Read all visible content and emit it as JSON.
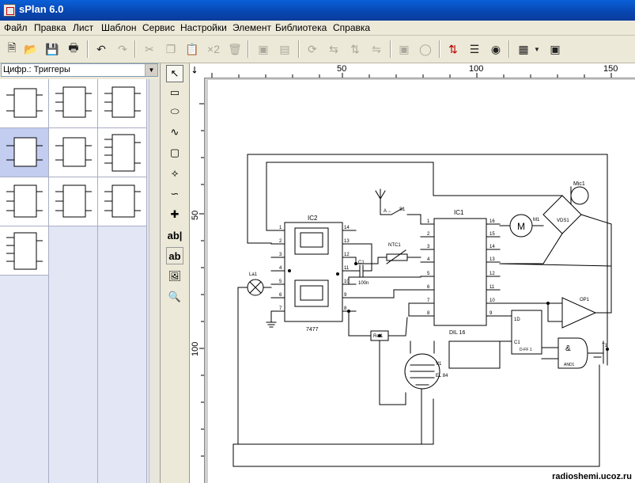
{
  "window": {
    "title": "sPlan 6.0"
  },
  "menu": [
    "Файл",
    "Правка",
    "Лист",
    "Шаблон",
    "Сервис",
    "Настройки",
    "Элемент",
    "Библиотека",
    "Справка"
  ],
  "library": {
    "selected": "Цифр.: Триггеры"
  },
  "ruler": {
    "h_ticks": [
      "50",
      "100",
      "150"
    ],
    "v_ticks": [
      "50",
      "100"
    ]
  },
  "schematic": {
    "ic2_label": "IC2",
    "ic2_part": "7477",
    "ic1_label": "IC1",
    "ic1_part": "DIL 16",
    "ic1_left_pins": [
      "1",
      "2",
      "3",
      "4",
      "5",
      "6",
      "7",
      "8"
    ],
    "ic1_right_pins": [
      "16",
      "15",
      "14",
      "13",
      "12",
      "11",
      "10",
      "9"
    ],
    "ic2_left_pins": [
      "1",
      "2",
      "3",
      "4",
      "5",
      "6",
      "7"
    ],
    "ic2_right_pins": [
      "14",
      "13",
      "12",
      "11",
      "10",
      "9",
      "8"
    ],
    "mic": "Mic1",
    "motor": "M1",
    "motor_sym": "M",
    "bridge": "VDS1",
    "antenna": "A→",
    "switch": "S1",
    "ntc": "NTC1",
    "cap": "C1",
    "cap_val": "100n",
    "lamp": "La1",
    "relay": "Rel1",
    "tube": "V1",
    "tube_type": "EL 84",
    "opamp": "OP1",
    "transistor": "T1",
    "dff_d": "1D",
    "dff_c": "C1",
    "dff_part": "D-FF 1",
    "and_sym": "&",
    "and_part": "AND1"
  },
  "watermark": "radioshemi.ucoz.ru"
}
